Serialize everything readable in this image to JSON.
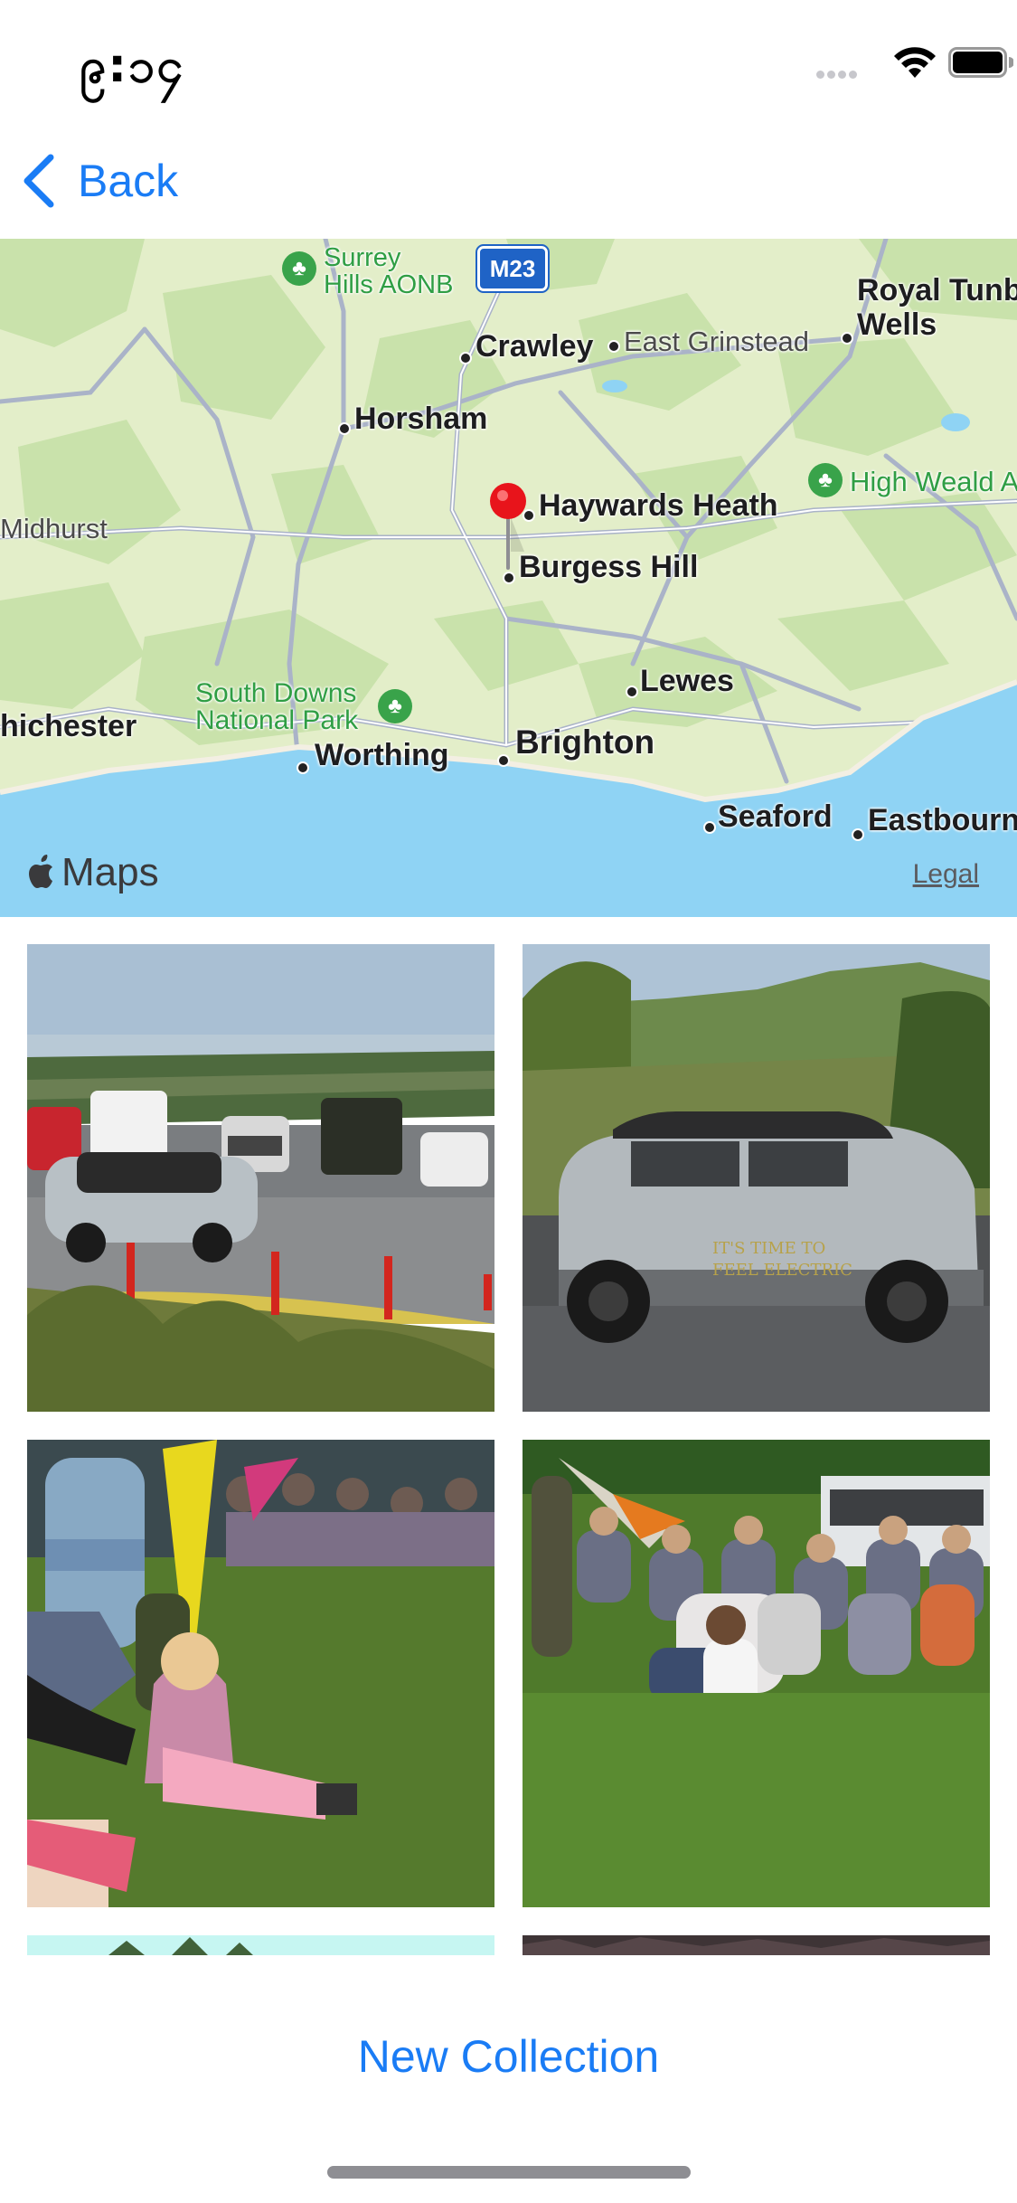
{
  "status_bar": {
    "time": "၉:၁၄",
    "icons": [
      "signal-icon",
      "wifi-icon",
      "battery-icon"
    ]
  },
  "nav": {
    "back_label": "Back"
  },
  "map": {
    "pin_color": "#e8141b",
    "water_color": "#8fd3f4",
    "land_color": "#e3eec9",
    "park_color": "#c6e3a8",
    "places": {
      "surrey_hills": "Surrey\nHills AONB",
      "motorway": "M23",
      "crawley": "Crawley",
      "east_grinstead": "East Grinstead",
      "royal_tunbridge": "Royal Tunb\nWells",
      "horsham": "Horsham",
      "midhurst": "Midhurst",
      "haywards_heath": "Haywards Heath",
      "burgess_hill": "Burgess Hill",
      "high_weald": "High Weald A",
      "south_downs": "South Downs\nNational Park",
      "lewes": "Lewes",
      "chichester": "hichester",
      "worthing": "Worthing",
      "brighton": "Brighton",
      "seaford": "Seaford",
      "eastbourne": "Eastbourn"
    },
    "brand": "Maps",
    "legal_label": "Legal"
  },
  "photos": [
    {
      "name": "photo-car-park-viewpoint"
    },
    {
      "name": "photo-electric-mini-car"
    },
    {
      "name": "photo-crowd-child-flag"
    },
    {
      "name": "photo-crowd-on-grass"
    }
  ],
  "car_decal": {
    "line1": "IT'S TIME TO",
    "line2": "FEEL ELECTRIC"
  },
  "actions": {
    "new_collection_label": "New Collection"
  }
}
